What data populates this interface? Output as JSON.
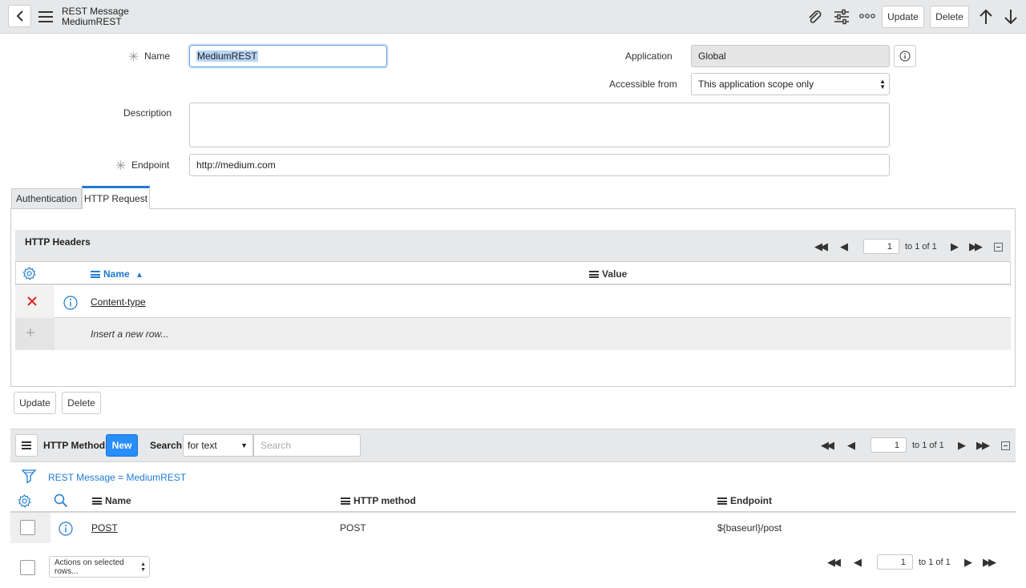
{
  "header": {
    "type_label": "REST Message",
    "record_label": "MediumREST",
    "update_label": "Update",
    "delete_label": "Delete"
  },
  "form": {
    "name_label": "Name",
    "name_value": "MediumREST",
    "description_label": "Description",
    "description_value": "",
    "endpoint_label": "Endpoint",
    "endpoint_value": "http://medium.com",
    "application_label": "Application",
    "application_value": "Global",
    "accessible_label": "Accessible from",
    "accessible_value": "This application scope only"
  },
  "tabs": [
    "Authentication",
    "HTTP Request"
  ],
  "headers_section": {
    "title": "HTTP Headers",
    "pager": {
      "page": "1",
      "range": "to 1 of 1"
    },
    "col_name": "Name",
    "col_value": "Value",
    "rows": [
      {
        "name": "Content-type",
        "value": ""
      }
    ],
    "insert_row": "Insert a new row..."
  },
  "form_buttons": {
    "update": "Update",
    "delete": "Delete"
  },
  "methods": {
    "title": "HTTP Methods",
    "new_label": "New",
    "search_label": "Search",
    "search_field": "for text",
    "search_placeholder": "Search",
    "filter_text": "REST Message = MediumREST",
    "pager": {
      "page": "1",
      "range": "to 1 of 1"
    },
    "columns": [
      "Name",
      "HTTP method",
      "Endpoint"
    ],
    "rows": [
      {
        "name": "POST",
        "method": "POST",
        "endpoint": "${baseurl}/post"
      }
    ],
    "actions_label": "Actions on selected rows...",
    "bottom_pager": {
      "page": "1",
      "range": "to 1 of 1"
    }
  },
  "colors": {
    "accent": "#1f7ad1",
    "header_bg": "#e6e8ea",
    "new_btn": "#278efc",
    "delete_red": "#e0261f"
  }
}
